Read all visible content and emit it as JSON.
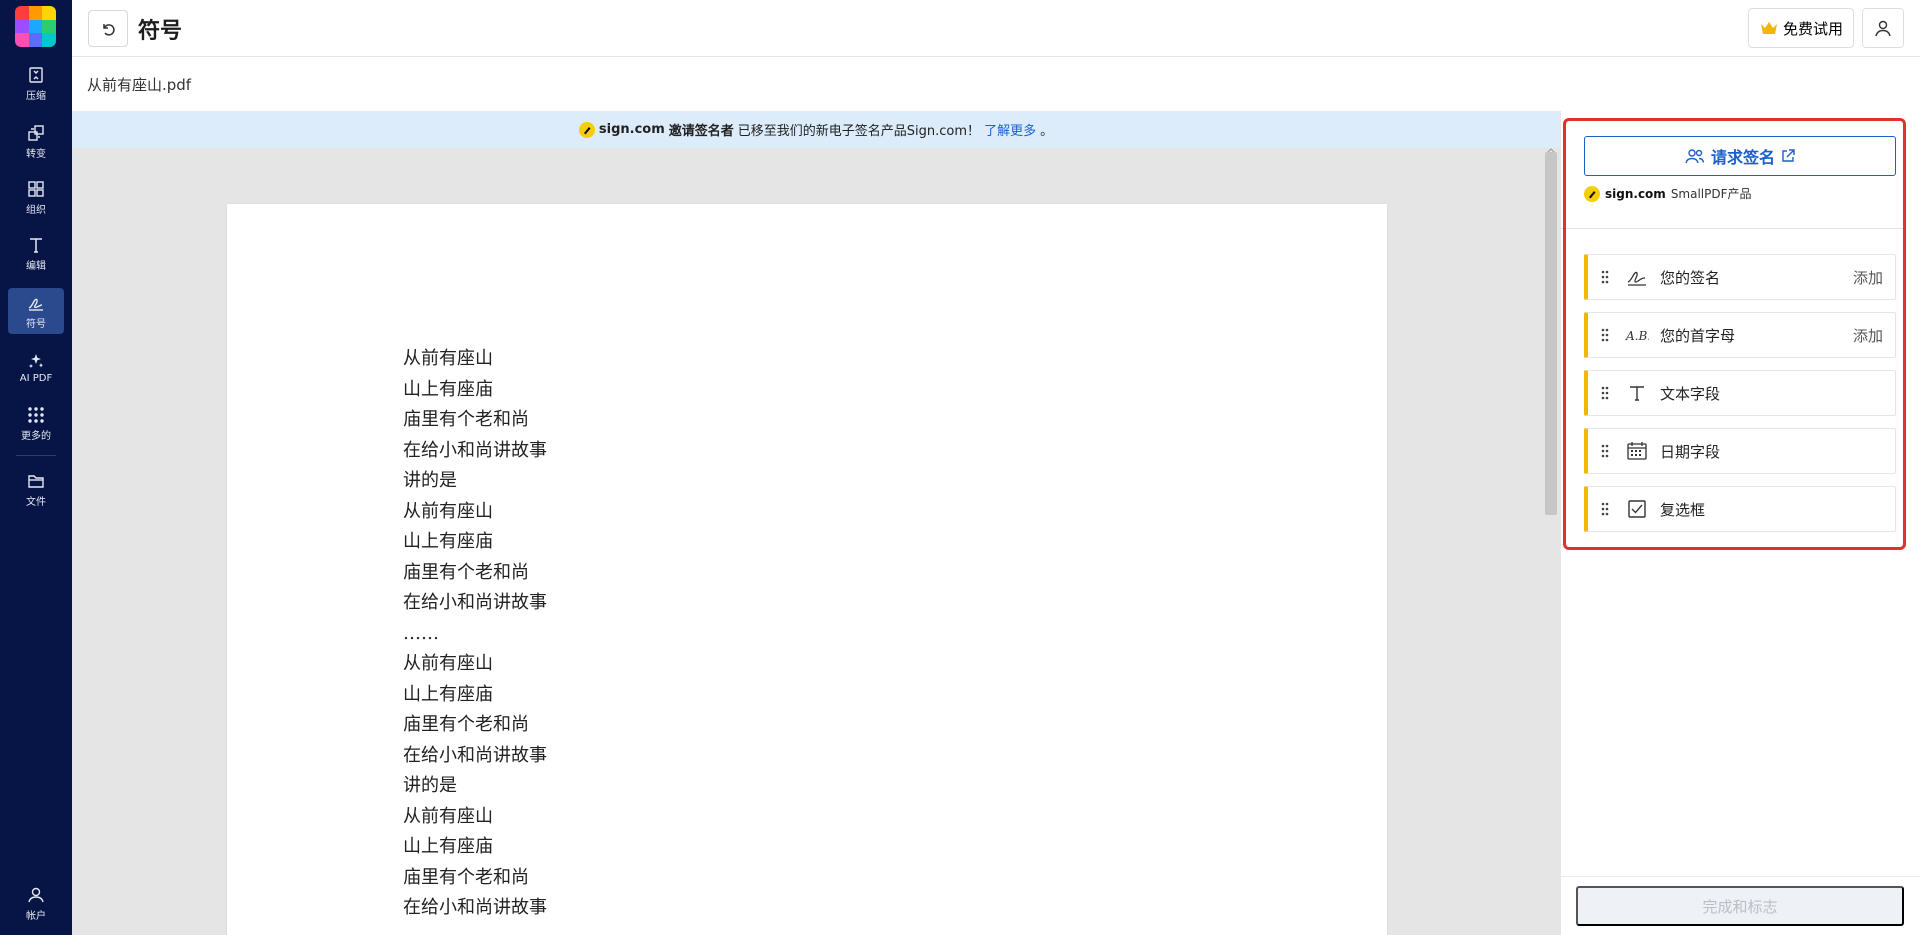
{
  "app": {
    "rail": [
      {
        "name": "compress",
        "label": "压缩",
        "icon": "compress-icon"
      },
      {
        "name": "convert",
        "label": "转变",
        "icon": "convert-icon"
      },
      {
        "name": "organize",
        "label": "组织",
        "icon": "grid-icon"
      },
      {
        "name": "edit",
        "label": "编辑",
        "icon": "text-icon"
      },
      {
        "name": "sign",
        "label": "符号",
        "icon": "signature-icon",
        "active": true
      },
      {
        "name": "ai-pdf",
        "label": "AI PDF",
        "icon": "sparkle-icon"
      },
      {
        "name": "more",
        "label": "更多的",
        "icon": "apps-icon"
      },
      {
        "name": "files",
        "label": "文件",
        "icon": "folder-icon"
      },
      {
        "name": "account",
        "label": "帐户",
        "icon": "user-icon"
      }
    ]
  },
  "header": {
    "title": "符号",
    "trial_label": "免费试用"
  },
  "document": {
    "filename": "从前有座山.pdf",
    "lines": [
      "从前有座山",
      "山上有座庙",
      "庙里有个老和尚",
      "在给小和尚讲故事",
      "讲的是",
      "从前有座山",
      "山上有座庙",
      "庙里有个老和尚",
      "在给小和尚讲故事",
      "……",
      "从前有座山",
      "山上有座庙",
      "庙里有个老和尚",
      "在给小和尚讲故事",
      "讲的是",
      "从前有座山",
      "山上有座庙",
      "庙里有个老和尚",
      "在给小和尚讲故事"
    ]
  },
  "banner": {
    "brand": "sign.com",
    "bold_text": "邀请签名者",
    "text": "已移至我们的新电子签名产品Sign.com！",
    "link": "了解更多",
    "end": "。"
  },
  "panel": {
    "request_label": "请求签名",
    "brand": "sign.com",
    "brand_suffix": "SmallPDF产品",
    "fields": [
      {
        "label": "您的签名",
        "action": "添加",
        "icon": "signature-icon"
      },
      {
        "label": "您的首字母",
        "action": "添加",
        "icon": "initials-icon"
      },
      {
        "label": "文本字段",
        "action": "",
        "icon": "text-icon"
      },
      {
        "label": "日期字段",
        "action": "",
        "icon": "calendar-icon"
      },
      {
        "label": "复选框",
        "action": "",
        "icon": "checkbox-icon"
      }
    ],
    "finish_label": "完成和标志"
  },
  "colors": {
    "rail_bg": "#061545",
    "accent_blue": "#1b5fcc",
    "field_accent": "#f2b705",
    "highlight": "#e0322b"
  }
}
